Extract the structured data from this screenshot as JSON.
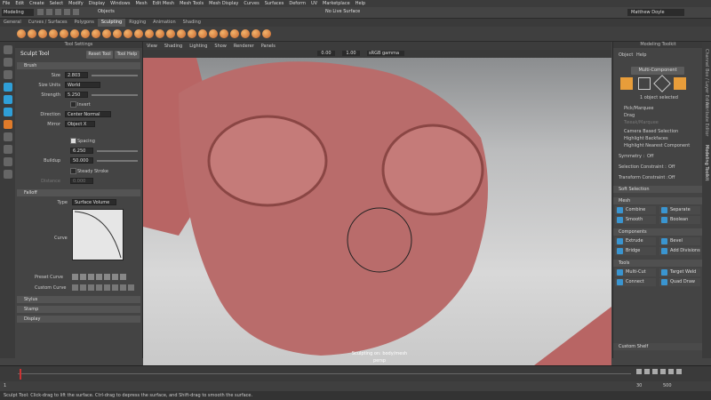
{
  "menu": [
    "File",
    "Edit",
    "Create",
    "Select",
    "Modify",
    "Display",
    "Windows",
    "Mesh",
    "Edit Mesh",
    "Mesh Tools",
    "Mesh Display",
    "Curves",
    "Surfaces",
    "Deform",
    "UV",
    "Marketplace",
    "Help"
  ],
  "status": {
    "mode": "Modeling",
    "objects_label": "Objects",
    "live": "No Live Surface",
    "user": "Matthew Doyle"
  },
  "shelf_tabs": [
    "General",
    "Curves / Surfaces",
    "Polygons",
    "Sculpting",
    "Rigging",
    "Animation",
    "Shading"
  ],
  "active_shelf_tab": "Sculpting",
  "tool_settings": {
    "header": "Tool Settings",
    "tool_name": "Sculpt Tool",
    "reset_button": "Reset Tool",
    "help_button": "Tool Help",
    "brush_section": "Brush",
    "size_label": "Size",
    "size_value": "2.803",
    "size_units_label": "Size Units",
    "size_units_value": "World",
    "strength_label": "Strength",
    "strength_value": "5.250",
    "invert_label": "Invert",
    "direction_label": "Direction",
    "direction_value": "Center Normal",
    "mirror_label": "Mirror",
    "mirror_value": "Object X",
    "spacing_label": "Spacing",
    "spacing_value": "6.250",
    "buildup_label": "Buildup",
    "buildup_value": "50.000",
    "steady_label": "Steady Stroke",
    "distance_label": "Distance",
    "distance_value": "0.000",
    "falloff_section": "Falloff",
    "type_label": "Type",
    "type_value": "Surface Volume",
    "curve_label": "Curve",
    "preset_curve_label": "Preset Curve",
    "custom_curve_label": "Custom Curve",
    "stylus_section": "Stylus",
    "stamp_section": "Stamp",
    "display_section": "Display"
  },
  "viewport": {
    "menu": [
      "View",
      "Shading",
      "Lighting",
      "Show",
      "Renderer",
      "Panels"
    ],
    "value1": "0.00",
    "value2": "1.00",
    "color_space": "sRGB gamma",
    "overlay_title": "Sculpting on: body/mesh",
    "camera": "persp"
  },
  "toolkit": {
    "header": "Modeling Toolkit",
    "menu": [
      "Object",
      "Help"
    ],
    "multi_component": "Multi-Component",
    "selected": "1 object selected",
    "options": [
      "Pick/Marquee",
      "Drag",
      "Tweak/Marquee",
      "Camera Based Selection",
      "Highlight Backfaces",
      "Highlight Nearest Component"
    ],
    "symmetry_label": "Symmetry :",
    "symmetry_value": "Off",
    "sel_constraint_label": "Selection Constraint :",
    "sel_constraint_value": "Off",
    "transform_constraint_label": "Transform Constraint :",
    "transform_constraint_value": "Off",
    "soft_selection": "Soft Selection",
    "mesh_section": "Mesh",
    "mesh_buttons": [
      "Combine",
      "Separate",
      "Smooth",
      "Boolean"
    ],
    "components_section": "Components",
    "component_buttons": [
      "Extrude",
      "Bevel",
      "Bridge",
      "Add Divisions"
    ],
    "tools_section": "Tools",
    "tool_buttons": [
      "Multi-Cut",
      "Target Weld",
      "Connect",
      "Quad Draw"
    ],
    "custom_shelf": "Custom Shelf"
  },
  "sidebar_tabs": [
    "Channel Box / Layer Editor",
    "Attribute Editor",
    "Modeling Toolkit"
  ],
  "timeline": {
    "start": "1",
    "end": "30",
    "range_end": "500",
    "current": "1"
  },
  "help_line": "Sculpt Tool: Click-drag to lift the surface. Ctrl-drag to depress the surface, and Shift-drag to smooth the surface."
}
